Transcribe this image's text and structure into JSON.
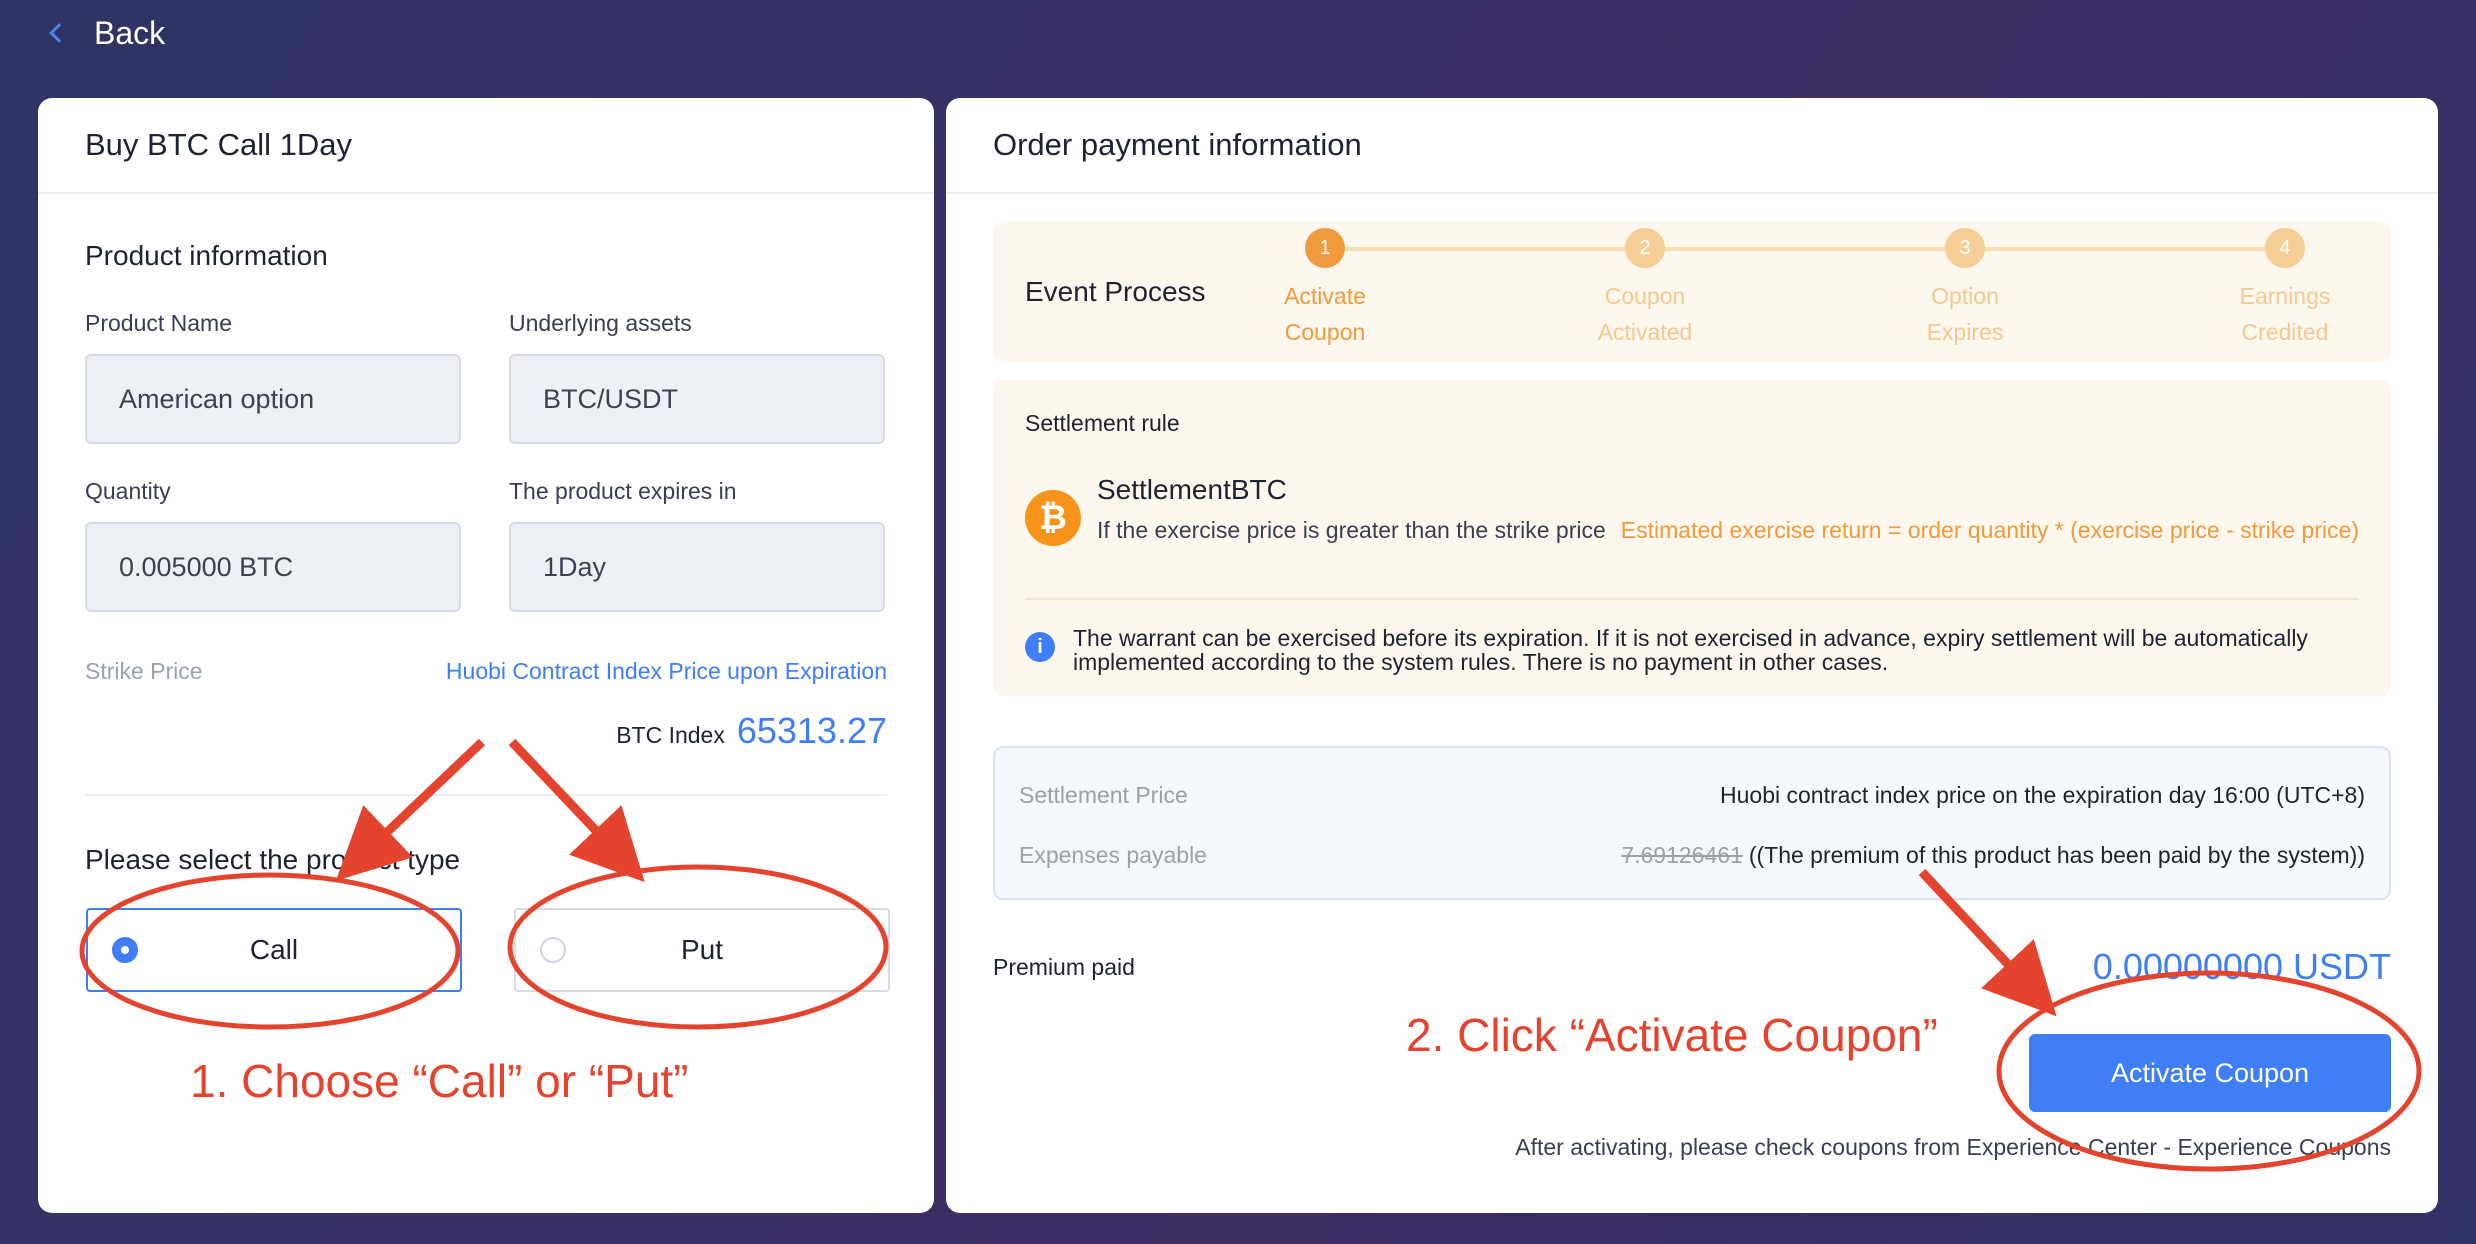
{
  "nav": {
    "back_label": "Back"
  },
  "left": {
    "title": "Buy  BTC  Call 1Day",
    "product_section": "Product information",
    "product_name_label": "Product Name",
    "product_name_value": "American option",
    "underlying_label": "Underlying assets",
    "underlying_value": "BTC/USDT",
    "quantity_label": "Quantity",
    "quantity_value": "0.005000 BTC",
    "expires_label": "The product expires in",
    "expires_value": "1Day",
    "strike_label": "Strike Price",
    "strike_value": "Huobi Contract Index Price upon Expiration",
    "btc_index_label": "BTC Index",
    "btc_index_value": "65313.27",
    "select_type_title": "Please select the product type",
    "type_options": [
      {
        "label": "Call",
        "selected": true
      },
      {
        "label": "Put",
        "selected": false
      }
    ]
  },
  "right": {
    "title": "Order payment information",
    "event_process_label": "Event Process",
    "steps": [
      {
        "number": "1",
        "line1": "Activate",
        "line2": "Coupon",
        "active": true
      },
      {
        "number": "2",
        "line1": "Coupon",
        "line2": "Activated",
        "active": false
      },
      {
        "number": "3",
        "line1": "Option",
        "line2": "Expires",
        "active": false
      },
      {
        "number": "4",
        "line1": "Earnings",
        "line2": "Credited",
        "active": false
      }
    ],
    "settlement_rule_title": "Settlement rule",
    "settlement_name": "SettlementBTC",
    "settlement_condition": "If the exercise price is greater than the strike price",
    "settlement_formula": "Estimated exercise return = order quantity * (exercise price - strike price)",
    "info_text": "The warrant can be exercised before its expiration. If it is not exercised in advance, expiry settlement will be automatically implemented according to the system rules. There is no payment in other cases.",
    "settlement_price_label": "Settlement Price",
    "settlement_price_value": "Huobi contract index price on the expiration day 16:00 (UTC+8)",
    "expenses_label": "Expenses payable",
    "expenses_original": "7.69126461",
    "expenses_note": "((The premium of this product has been paid by the system))",
    "premium_label": "Premium paid",
    "premium_value": "0.00000000 USDT",
    "activate_button": "Activate Coupon",
    "after_note": "After activating, please check coupons from Experience Center - Experience Coupons"
  },
  "annotations": {
    "step1": "1. Choose “Call” or “Put”",
    "step2": "2. Click “Activate Coupon”"
  },
  "colors": {
    "accent_blue": "#3f7ef5",
    "step_orange": "#ef9a3c",
    "annotation_red": "#e4432e",
    "bitcoin_orange": "#f7931a"
  },
  "icons": {
    "back": "chevron-left-icon",
    "coin": "bitcoin-icon",
    "info": "info-icon"
  }
}
